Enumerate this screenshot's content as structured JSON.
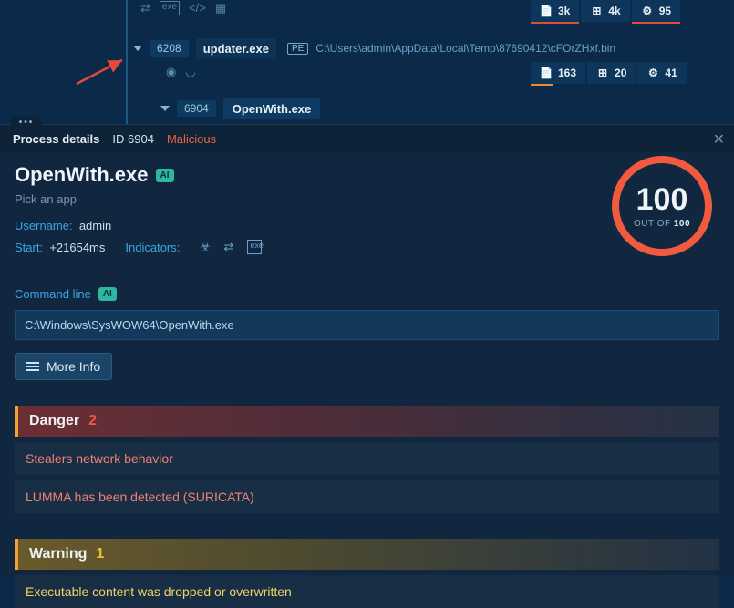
{
  "tree": {
    "row1": {
      "stats": {
        "a": "3k",
        "b": "4k",
        "c": "95"
      }
    },
    "row2": {
      "pid": "6208",
      "exe": "updater.exe",
      "tag": "PE",
      "path": "C:\\Users\\admin\\AppData\\Local\\Temp\\87690412\\cFOrZHxf.bin",
      "stats": {
        "a": "163",
        "b": "20",
        "c": "41"
      }
    },
    "row3": {
      "pid": "6904",
      "exe": "OpenWith.exe"
    }
  },
  "panel": {
    "header": {
      "title": "Process details",
      "id_label": "ID 6904",
      "status": "Malicious"
    },
    "process": {
      "name": "OpenWith.exe",
      "ai": "AI",
      "subtitle": "Pick an app",
      "username_k": "Username:",
      "username_v": "admin",
      "start_k": "Start:",
      "start_v": "+21654ms",
      "indicators_k": "Indicators:"
    },
    "score": {
      "value": "100",
      "out_of_label": "OUT OF",
      "out_of_value": "100"
    },
    "command": {
      "label": "Command line",
      "ai": "AI",
      "value": "C:\\Windows\\SysWOW64\\OpenWith.exe"
    },
    "more_info": "More Info",
    "danger": {
      "title": "Danger",
      "count": "2",
      "items": [
        "Stealers network behavior",
        "LUMMA has been detected (SURICATA)"
      ]
    },
    "warning": {
      "title": "Warning",
      "count": "1",
      "items": [
        "Executable content was dropped or overwritten"
      ]
    }
  }
}
